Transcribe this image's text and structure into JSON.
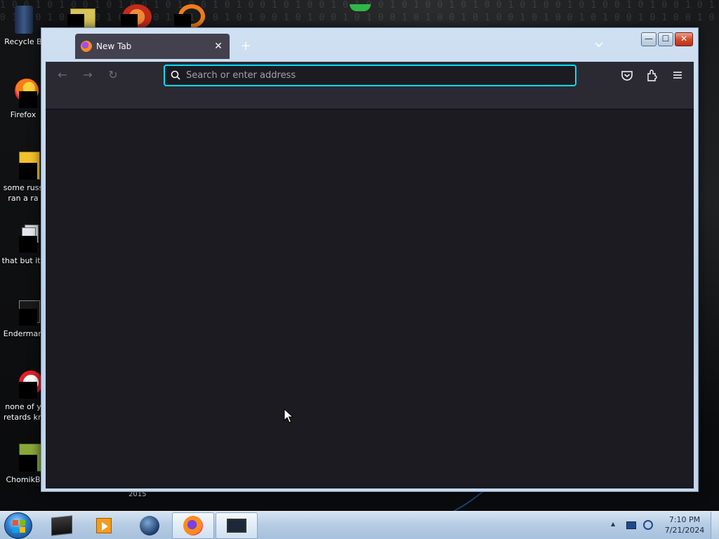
{
  "desktop": {
    "icons": [
      {
        "label": "Recycle B",
        "icon": "recycle-bin-icon"
      },
      {
        "label": "Firefox",
        "icon": "firefox-icon"
      },
      {
        "label": "some russ",
        "label2": "ran a ra",
        "icon": "document-icon"
      },
      {
        "label": "that but its",
        "icon": "folder-stack-icon"
      },
      {
        "label": "Enderman",
        "icon": "window-icon"
      },
      {
        "label": "none of y",
        "label2": "retards kn",
        "icon": "opera-icon"
      },
      {
        "label": "ChomikB",
        "icon": "chomik-icon"
      }
    ],
    "year_label": "2015"
  },
  "browser": {
    "tab_title": "New Tab",
    "tab_close": "✕",
    "new_tab": "+",
    "tab_list": "⌄",
    "url_placeholder": "Search or enter address",
    "url_value": "",
    "back": "←",
    "forward": "→",
    "reload": "↻",
    "caption": {
      "minimize": "—",
      "maximize": "☐",
      "close": "✕"
    }
  },
  "taskbar": {
    "clock_time": "7:10 PM",
    "clock_date": "7/21/2024",
    "tray_arrow": "▲",
    "items": [
      "terminal-icon",
      "media-player-icon",
      "globe-icon",
      "firefox-icon",
      "monitor-icon"
    ]
  },
  "colors": {
    "accent_focus": "#00ddff",
    "browser_bg": "#1c1b22",
    "toolbar_bg": "#2b2a33"
  }
}
